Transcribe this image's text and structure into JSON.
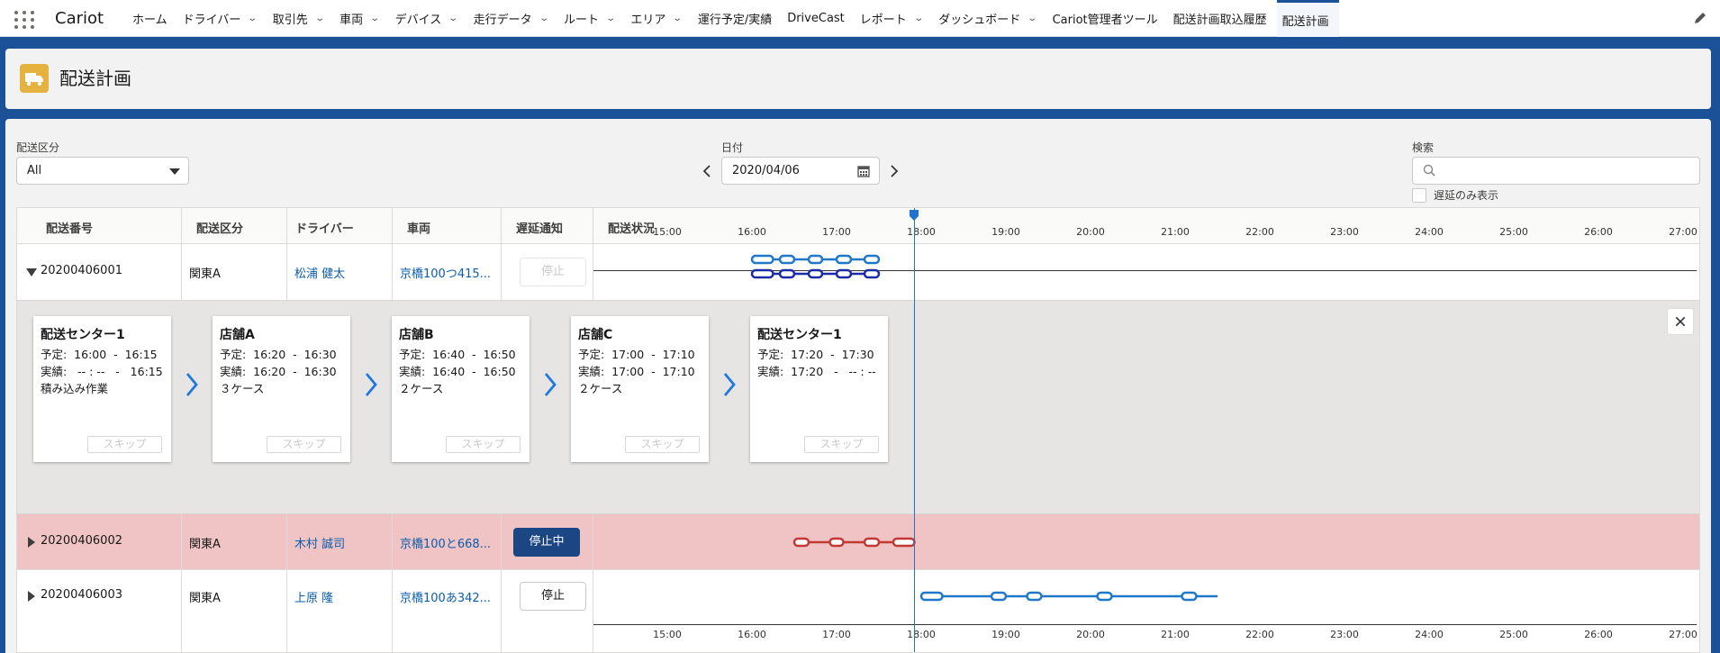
{
  "app": {
    "name": "Cariot"
  },
  "nav": {
    "items": [
      {
        "label": "ホーム",
        "dropdown": false
      },
      {
        "label": "ドライバー",
        "dropdown": true
      },
      {
        "label": "取引先",
        "dropdown": true
      },
      {
        "label": "車両",
        "dropdown": true
      },
      {
        "label": "デバイス",
        "dropdown": true
      },
      {
        "label": "走行データ",
        "dropdown": true
      },
      {
        "label": "ルート",
        "dropdown": true
      },
      {
        "label": "エリア",
        "dropdown": true
      },
      {
        "label": "運行予定/実績",
        "dropdown": false
      },
      {
        "label": "DriveCast",
        "dropdown": false
      },
      {
        "label": "レポート",
        "dropdown": true
      },
      {
        "label": "ダッシュボード",
        "dropdown": true
      },
      {
        "label": "Cariot管理者ツール",
        "dropdown": false
      },
      {
        "label": "配送計画取込履歴",
        "dropdown": false
      },
      {
        "label": "配送計画",
        "dropdown": false,
        "active": true
      }
    ]
  },
  "page": {
    "title": "配送計画",
    "icon": "truck-icon"
  },
  "filters": {
    "kubun_label": "配送区分",
    "kubun_value": "All",
    "date_label": "日付",
    "date_value": "2020/04/06",
    "search_label": "検索",
    "search_placeholder": "",
    "delay_only_label": "遅延のみ表示"
  },
  "table": {
    "columns": [
      "配送番号",
      "配送区分",
      "ドライバー",
      "車両",
      "遅延通知",
      "配送状況"
    ],
    "rows": [
      {
        "number": "20200406001",
        "kubun": "関東A",
        "driver": "松浦 健太",
        "vehicle": "京橋100つ415...",
        "notify": "停止",
        "notify_state": "disabled",
        "expanded": true
      },
      {
        "number": "20200406002",
        "kubun": "関東A",
        "driver": "木村 誠司",
        "vehicle": "京橋100と668...",
        "notify": "停止中",
        "notify_state": "active",
        "expanded": false,
        "delayed": true
      },
      {
        "number": "20200406003",
        "kubun": "関東A",
        "driver": "上原 隆",
        "vehicle": "京橋100あ342...",
        "notify": "停止",
        "notify_state": "normal",
        "expanded": false
      }
    ]
  },
  "stops": [
    {
      "name": "配送センター1",
      "plan": "予定:  16:00  -  16:15",
      "actual": "実績:   -- : --   -   16:15",
      "note": "積み込み作業",
      "skip": "スキップ"
    },
    {
      "name": "店舗A",
      "plan": "予定:  16:20  -  16:30",
      "actual": "実績:  16:20  -  16:30",
      "note": "３ケース",
      "skip": "スキップ"
    },
    {
      "name": "店舗B",
      "plan": "予定:  16:40  -  16:50",
      "actual": "実績:  16:40  -  16:50",
      "note": "２ケース",
      "skip": "スキップ"
    },
    {
      "name": "店舗C",
      "plan": "予定:  17:00  -  17:10",
      "actual": "実績:  17:00  -  17:10",
      "note": "２ケース",
      "skip": "スキップ"
    },
    {
      "name": "配送センター1",
      "plan": "予定:  17:20  -  17:30",
      "actual": "実績:  17:20   -   -- : --",
      "note": "",
      "skip": "スキップ"
    }
  ],
  "timeline": {
    "ticks": [
      "15:00",
      "16:00",
      "17:00",
      "18:00",
      "19:00",
      "20:00",
      "21:00",
      "22:00",
      "23:00",
      "24:00",
      "25:00",
      "26:00",
      "27:00"
    ],
    "now": "17:55",
    "colors": {
      "plan": "#1f78c8",
      "actual": "#1b2aa8",
      "delayed": "#c23934",
      "now": "#2273c9"
    },
    "row1_plan": [
      [
        16.0,
        16.25
      ],
      [
        16.33,
        16.5
      ],
      [
        16.67,
        16.83
      ],
      [
        17.0,
        17.17
      ],
      [
        17.33,
        17.5
      ]
    ],
    "row1_actual": [
      [
        16.0,
        16.25
      ],
      [
        16.33,
        16.5
      ],
      [
        16.67,
        16.83
      ],
      [
        17.0,
        17.17
      ],
      [
        17.33,
        17.5
      ]
    ],
    "row2": [
      [
        16.5,
        16.67
      ],
      [
        16.92,
        17.08
      ],
      [
        17.33,
        17.5
      ],
      [
        17.67,
        17.92
      ]
    ],
    "row3": [
      [
        18.0,
        18.25
      ],
      [
        18.83,
        19.0
      ],
      [
        19.25,
        19.42
      ],
      [
        20.08,
        20.25
      ],
      [
        21.08,
        21.25
      ]
    ],
    "row3_end": 21.5
  }
}
